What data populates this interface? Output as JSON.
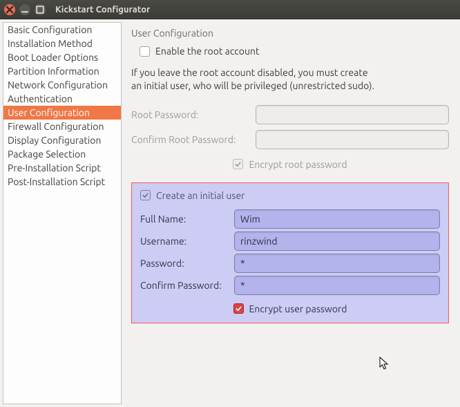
{
  "window": {
    "title": "Kickstart Configurator"
  },
  "sidebar": {
    "items": [
      {
        "label": "Basic Configuration"
      },
      {
        "label": "Installation Method"
      },
      {
        "label": "Boot Loader Options"
      },
      {
        "label": "Partition Information"
      },
      {
        "label": "Network Configuration"
      },
      {
        "label": "Authentication"
      },
      {
        "label": "User Configuration"
      },
      {
        "label": "Firewall Configuration"
      },
      {
        "label": "Display Configuration"
      },
      {
        "label": "Package Selection"
      },
      {
        "label": "Pre-Installation Script"
      },
      {
        "label": "Post-Installation Script"
      }
    ],
    "selected_index": 6
  },
  "main": {
    "section_title": "User Configuration",
    "enable_root_label": "Enable the root account",
    "enable_root_checked": false,
    "info_line1": "If you leave the root account disabled, you must create",
    "info_line2": "an initial user, who will be privileged (unrestricted sudo).",
    "root_password_label": "Root Password:",
    "root_password_value": "",
    "confirm_root_label": "Confirm Root Password:",
    "confirm_root_value": "",
    "encrypt_root_label": "Encrypt root password",
    "encrypt_root_checked": true,
    "initial_user": {
      "create_label": "Create an initial user",
      "create_checked": true,
      "full_name_label": "Full Name:",
      "full_name_value": "Wim",
      "username_label": "Username:",
      "username_value": "rinzwind",
      "password_label": "Password:",
      "password_value": "*",
      "confirm_password_label": "Confirm Password:",
      "confirm_password_value": "*",
      "encrypt_label": "Encrypt user password",
      "encrypt_checked": true
    }
  }
}
